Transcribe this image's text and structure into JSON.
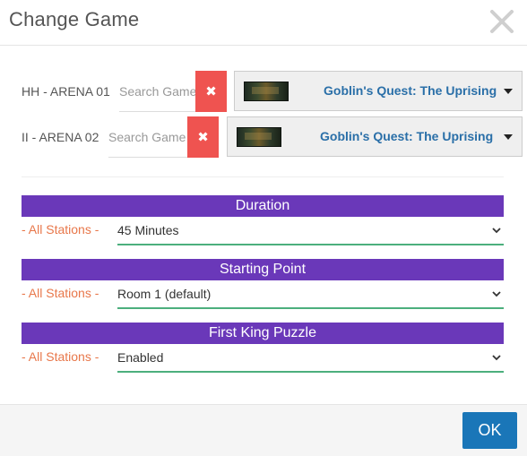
{
  "dialog": {
    "title": "Change Game",
    "close_icon": "close-icon"
  },
  "stations": [
    {
      "name": "HH - ARENA 01",
      "search_placeholder": "Search Game",
      "clear_icon": "x-icon",
      "game_title": "Goblin's Quest: The Uprising"
    },
    {
      "name": "II - ARENA 02",
      "search_placeholder": "Search Game",
      "clear_icon": "x-icon",
      "game_title": "Goblin's Quest: The Uprising"
    }
  ],
  "options": [
    {
      "heading": "Duration",
      "scope": "- All Stations -",
      "value": "45 Minutes"
    },
    {
      "heading": "Starting Point",
      "scope": "- All Stations -",
      "value": "Room 1 (default)"
    },
    {
      "heading": "First King Puzzle",
      "scope": "- All Stations -",
      "value": "Enabled"
    }
  ],
  "footer": {
    "ok_label": "OK"
  },
  "colors": {
    "section_bar": "#6a38b9",
    "clear_button": "#ef5350",
    "game_title": "#2a6fa8",
    "scope_text": "#e8774a",
    "underline": "#4caf7d",
    "ok_button": "#1a76b8"
  }
}
